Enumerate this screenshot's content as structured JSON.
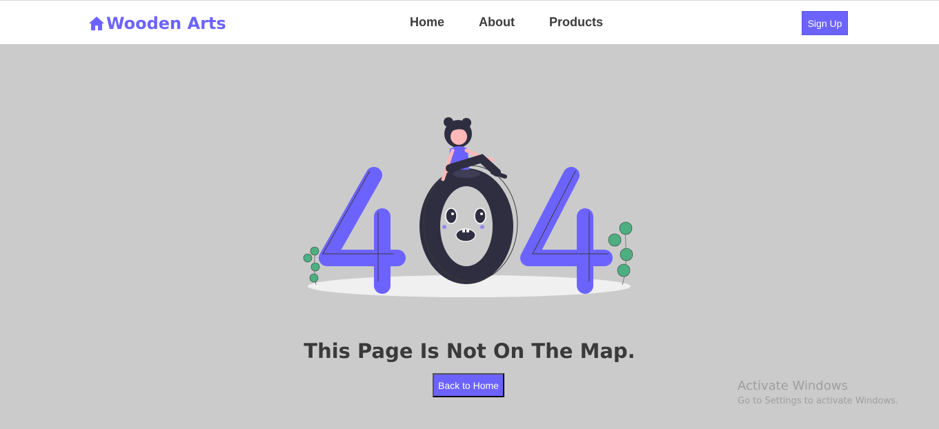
{
  "navbar": {
    "brand": "Wooden Arts",
    "brand_icon": "home-icon",
    "links": [
      "Home",
      "About",
      "Products"
    ],
    "signup_label": "Sign Up"
  },
  "main": {
    "illustration_text": "404",
    "heading": "This Page Is Not On The Map.",
    "back_label": "Back to Home"
  },
  "watermark": {
    "title": "Activate Windows",
    "subtitle": "Go to Settings to activate Windows."
  },
  "colors": {
    "accent": "#6c63ff",
    "page_bg": "#cbcbcb",
    "dark": "#2f2e41",
    "leaf": "#4caf82"
  }
}
